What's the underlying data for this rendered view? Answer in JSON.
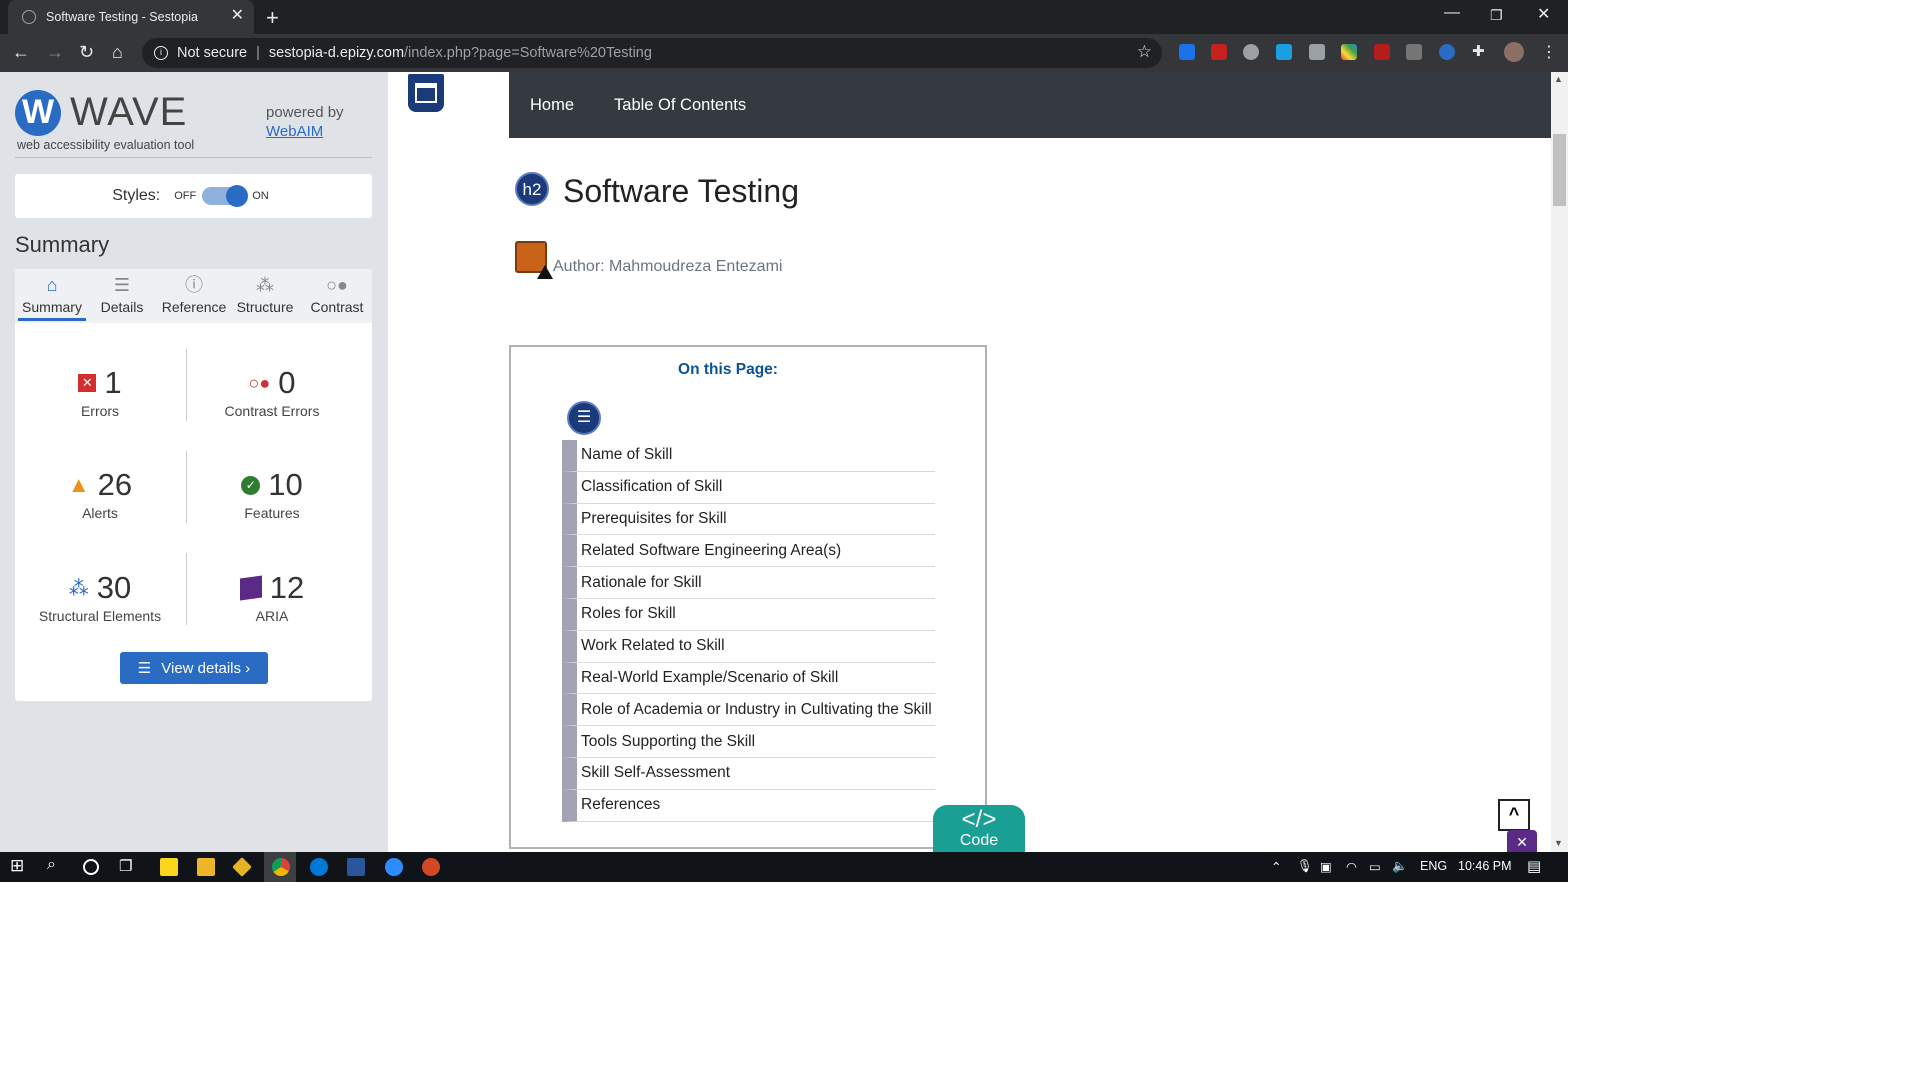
{
  "browser": {
    "tab_title": "Software Testing - Sestopia",
    "new_tab": "+",
    "security_label": "Not secure",
    "url_domain": "sestopia-d.epizy.com",
    "url_path": "/index.php?page=Software%20Testing"
  },
  "wave": {
    "logo_letter": "W",
    "title": "WAVE",
    "subtitle": "web accessibility evaluation tool",
    "powered_by": "powered by",
    "webaim_link": "WebAIM",
    "styles_label": "Styles:",
    "styles_off": "OFF",
    "styles_on": "ON",
    "summary_heading": "Summary",
    "tabs": [
      {
        "label": "Summary",
        "icon": "home-icon"
      },
      {
        "label": "Details",
        "icon": "list-icon"
      },
      {
        "label": "Reference",
        "icon": "info-icon"
      },
      {
        "label": "Structure",
        "icon": "hierarchy-icon"
      },
      {
        "label": "Contrast",
        "icon": "contrast-icon"
      }
    ],
    "stats": {
      "errors": {
        "count": "1",
        "label": "Errors"
      },
      "contrast_errors": {
        "count": "0",
        "label": "Contrast Errors"
      },
      "alerts": {
        "count": "26",
        "label": "Alerts"
      },
      "features": {
        "count": "10",
        "label": "Features"
      },
      "structural": {
        "count": "30",
        "label": "Structural Elements"
      },
      "aria": {
        "count": "12",
        "label": "ARIA"
      }
    },
    "view_details": "View details ›"
  },
  "page": {
    "nav": [
      "Home",
      "Table Of Contents"
    ],
    "h2_badge": "h2",
    "title": "Software Testing",
    "author": "Author: Mahmoudreza Entezami",
    "on_this_page": "On this Page:",
    "toc": [
      "Name of Skill",
      "Classification of Skill",
      "Prerequisites for Skill",
      "Related Software Engineering Area(s)",
      "Rationale for Skill",
      "Roles for Skill",
      "Work Related to Skill",
      "Real-World Example/Scenario of Skill",
      "Role of Academia or Industry in Cultivating the Skill",
      "Tools Supporting the Skill",
      "Skill Self-Assessment",
      "References"
    ],
    "code_button": "Code",
    "code_symbol": "</>"
  },
  "taskbar": {
    "language": "ENG",
    "time": "10:46 PM"
  },
  "colors": {
    "wave_blue": "#2a6bc4",
    "navbar": "#343a40",
    "toc_title": "#0b5394",
    "code_teal": "#1a9f94"
  }
}
